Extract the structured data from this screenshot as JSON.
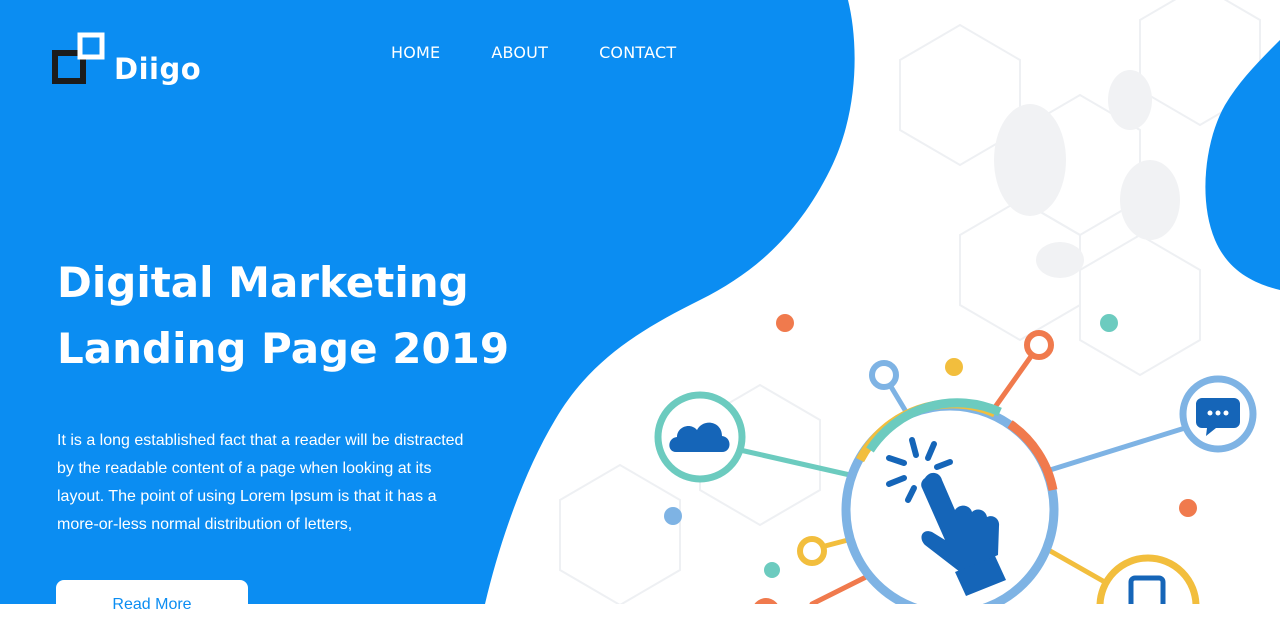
{
  "brand": {
    "name": "Diigo"
  },
  "nav": {
    "items": [
      "HOME",
      "ABOUT",
      "CONTACT"
    ]
  },
  "hero": {
    "title_line1": "Digital Marketing",
    "title_line2": "Landing Page 2019",
    "paragraph": "It is a long established fact that a reader will be distracted by the readable content of a page when looking at its layout. The point of using Lorem Ipsum is that it has a more-or-less normal distribution of letters,",
    "cta_label": "Read More"
  },
  "colors": {
    "primary_blue": "#0b8df2",
    "white": "#ffffff",
    "dark_blue": "#1565b8",
    "teal": "#6ccbbf",
    "orange": "#f07a4d",
    "yellow": "#f2be3d",
    "light_blue": "#7eb3e4"
  },
  "icons": [
    "cloud-icon",
    "chat-bubble-icon",
    "click-hand-icon",
    "smartphone-icon"
  ]
}
